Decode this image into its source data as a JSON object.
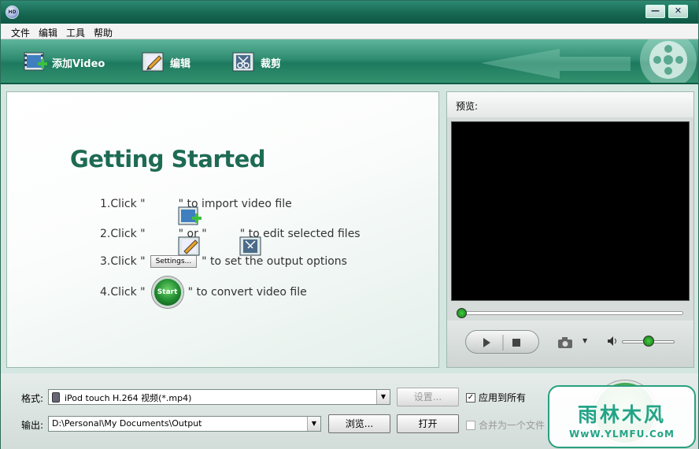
{
  "titlebar": {
    "app_icon_text": "HD",
    "minimize_glyph": "—",
    "close_glyph": "✕"
  },
  "menu": {
    "items": [
      {
        "label": "文件"
      },
      {
        "label": "编辑"
      },
      {
        "label": "工具"
      },
      {
        "label": "帮助"
      }
    ]
  },
  "toolbar": {
    "add_video_label": "添加Video",
    "edit_label": "编辑",
    "trim_label": "裁剪"
  },
  "getting_started": {
    "title": "Getting Started",
    "step1_prefix": "1.Click \"",
    "step1_suffix": "\" to import video file",
    "step2_prefix": "2.Click \"",
    "step2_middle": "\" or \"",
    "step2_suffix": "\" to edit selected files",
    "step3_prefix": "3.Click \"",
    "step3_button": "Settings...",
    "step3_suffix": "\" to set the output options",
    "step4_prefix": "4.Click \"",
    "step4_button": "Start",
    "step4_suffix": "\" to convert video file"
  },
  "preview": {
    "label": "预览:",
    "seek_position": 0,
    "volume_level": 0.5
  },
  "bottom": {
    "format_label": "格式:",
    "format_value": "iPod touch H.264 视频(*.mp4)",
    "settings_button": "设置...",
    "apply_all_label": "应用到所有",
    "apply_all_checked": true,
    "output_label": "输出:",
    "output_value": "D:\\Personal\\My Documents\\Output",
    "browse_button": "浏览...",
    "open_button": "打开",
    "merge_label": "合并为一个文件",
    "merge_checked": false
  },
  "watermark": {
    "name": "雨林木风",
    "url": "WwW.YLMFU.CoM"
  },
  "colors": {
    "toolbar_green": "#2f8c70",
    "title_green": "#1e6b53",
    "watermark_green": "#23a487"
  }
}
